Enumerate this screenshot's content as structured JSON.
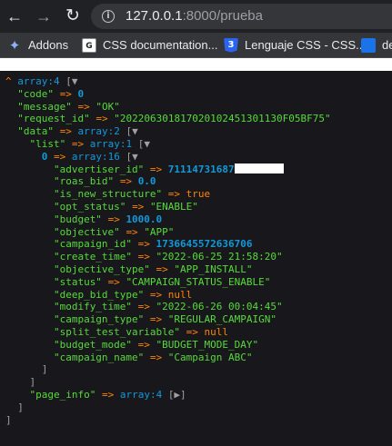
{
  "browser": {
    "url_host": "127.0.0.1",
    "url_rest": ":8000/prueba",
    "back_icon": "arrow-left",
    "forward_icon": "arrow-right",
    "reload_icon": "reload",
    "info_icon": "info"
  },
  "bookmarks": [
    {
      "label": "Addons",
      "icon": "puzzle"
    },
    {
      "label": "CSS documentation...",
      "icon": "mdn"
    },
    {
      "label": "Lenguaje CSS - CSS...",
      "icon": "css3"
    },
    {
      "label": "de",
      "icon": "bookmark"
    }
  ],
  "dump": {
    "caret": "^",
    "root_type": "array:4",
    "toggle_open": "▼",
    "toggle_closed": "▶",
    "code_key": "\"code\"",
    "code_val": "0",
    "message_key": "\"message\"",
    "message_val": "\"OK\"",
    "request_id_key": "\"request_id\"",
    "request_id_val": "\"2022063018170201024513011​30F05BF75\"",
    "data_key": "\"data\"",
    "data_type": "array:2",
    "list_key": "\"list\"",
    "list_type": "array:1",
    "item_index": "0",
    "item_type": "array:16",
    "fields": [
      {
        "key": "\"advertiser_id\"",
        "val": "71114731687",
        "kind": "num"
      },
      {
        "key": "\"roas_bid\"",
        "val": "0.0",
        "kind": "num"
      },
      {
        "key": "\"is_new_structure\"",
        "val": "true",
        "kind": "bool"
      },
      {
        "key": "\"opt_status\"",
        "val": "\"ENABLE\"",
        "kind": "str"
      },
      {
        "key": "\"budget\"",
        "val": "1000.0",
        "kind": "num"
      },
      {
        "key": "\"objective\"",
        "val": "\"APP\"",
        "kind": "str"
      },
      {
        "key": "\"campaign_id\"",
        "val": "1736645572636706",
        "kind": "num"
      },
      {
        "key": "\"create_time\"",
        "val": "\"2022-06-25 21:58:20\"",
        "kind": "str"
      },
      {
        "key": "\"objective_type\"",
        "val": "\"APP_INSTALL\"",
        "kind": "str"
      },
      {
        "key": "\"status\"",
        "val": "\"CAMPAIGN_STATUS_ENABLE\"",
        "kind": "str"
      },
      {
        "key": "\"deep_bid_type\"",
        "val": "null",
        "kind": "bool"
      },
      {
        "key": "\"modify_time\"",
        "val": "\"2022-06-26 00:04:45\"",
        "kind": "str"
      },
      {
        "key": "\"campaign_type\"",
        "val": "\"REGULAR_CAMPAIGN\"",
        "kind": "str"
      },
      {
        "key": "\"split_test_variable\"",
        "val": "null",
        "kind": "bool"
      },
      {
        "key": "\"budget_mode\"",
        "val": "\"BUDGET_MODE_DAY\"",
        "kind": "str"
      },
      {
        "key": "\"campaign_name\"",
        "val": "\"Campaign ABC\"",
        "kind": "str"
      }
    ],
    "page_info_key": "\"page_info\"",
    "page_info_type": "array:4",
    "arrow": "=>",
    "close_bracket": "]"
  },
  "colors": {
    "panel_bg": "#18171b",
    "key": "#56db3a",
    "string": "#56db3a",
    "number": "#1299da",
    "arrow": "#ff8400",
    "bool": "#ff8400"
  }
}
